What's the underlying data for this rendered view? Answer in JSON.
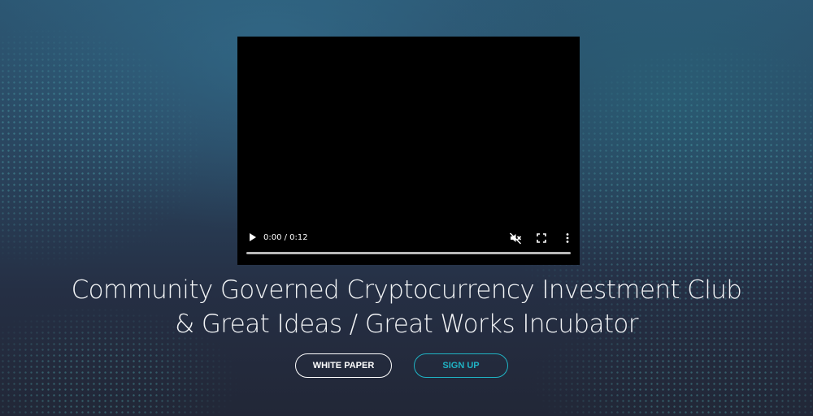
{
  "video": {
    "current_time": "0:00",
    "duration": "0:12",
    "time_label": "0:00 / 0:12",
    "progress": 0,
    "muted": true,
    "icons": {
      "play": "play-icon",
      "mute": "volume-muted-icon",
      "fullscreen": "fullscreen-icon",
      "more": "more-options-icon"
    }
  },
  "hero": {
    "headline_line1": "Community Governed Cryptocurrency Investment Club",
    "headline_line2": "& Great Ideas / Great Works Incubator"
  },
  "buttons": {
    "white_paper": "WHITE PAPER",
    "sign_up": "SIGN UP"
  },
  "colors": {
    "accent": "#1fb3c4",
    "text": "#f2f4f6",
    "background_top": "#2c5672",
    "background_bottom": "#222737"
  }
}
